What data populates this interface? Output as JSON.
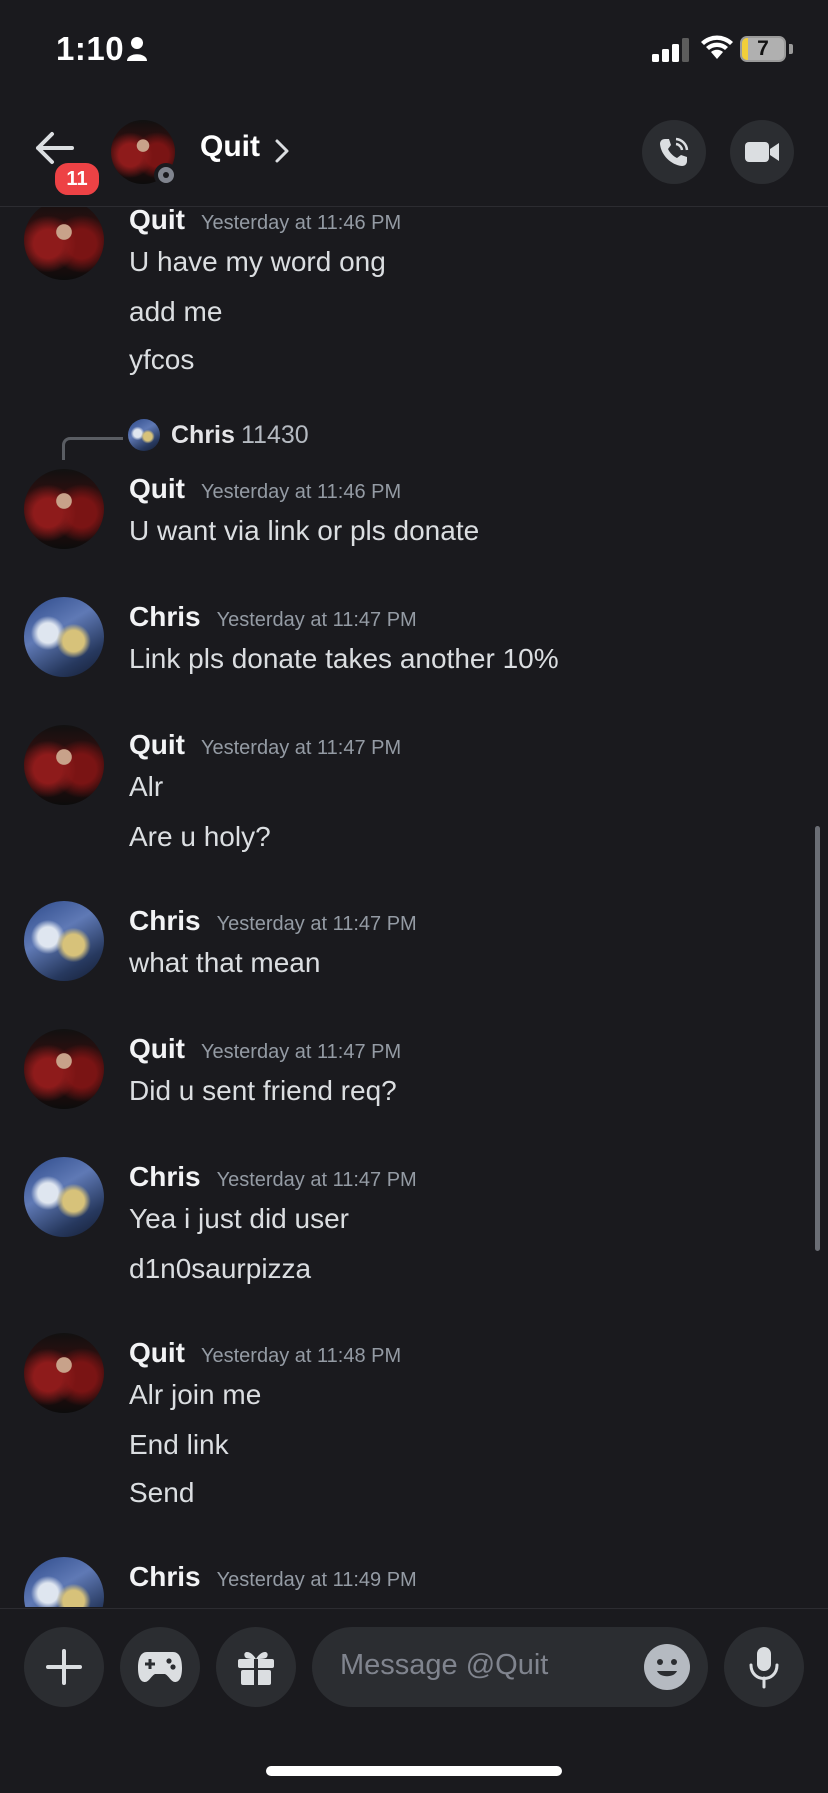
{
  "status_bar": {
    "time": "1:10",
    "battery": "7"
  },
  "header": {
    "back_badge": "11",
    "title": "Quit"
  },
  "reply_preview": {
    "name": "Chris",
    "text": "11430"
  },
  "messages": [
    {
      "author": "Quit",
      "timestamp": "Yesterday at 11:46 PM",
      "lines": [
        "U have my word ong",
        "add me",
        "yfcos"
      ]
    },
    {
      "author": "Quit",
      "timestamp": "Yesterday at 11:46 PM",
      "lines": [
        "U want via link or pls donate"
      ]
    },
    {
      "author": "Chris",
      "timestamp": "Yesterday at 11:47 PM",
      "lines": [
        "Link pls donate takes another 10%"
      ]
    },
    {
      "author": "Quit",
      "timestamp": "Yesterday at 11:47 PM",
      "lines": [
        "Alr",
        "Are u holy?"
      ]
    },
    {
      "author": "Chris",
      "timestamp": "Yesterday at 11:47 PM",
      "lines": [
        "what that mean"
      ]
    },
    {
      "author": "Quit",
      "timestamp": "Yesterday at 11:47 PM",
      "lines": [
        "Did u sent friend req?"
      ]
    },
    {
      "author": "Chris",
      "timestamp": "Yesterday at 11:47 PM",
      "lines": [
        "Yea i just did user",
        "d1n0saurpizza"
      ]
    },
    {
      "author": "Quit",
      "timestamp": "Yesterday at 11:48 PM",
      "lines": [
        "Alr join me",
        "End link",
        "Send"
      ]
    },
    {
      "author": "Chris",
      "timestamp": "Yesterday at 11:49 PM",
      "lines": []
    }
  ],
  "composer": {
    "placeholder": "Message @Quit"
  },
  "icons": [
    "person-icon",
    "signal-icon",
    "wifi-icon",
    "battery-icon",
    "back-arrow-icon",
    "chevron-right-icon",
    "phone-call-icon",
    "video-camera-icon",
    "plus-icon",
    "gamepad-icon",
    "gift-icon",
    "emoji-icon",
    "microphone-icon"
  ],
  "colors": {
    "background": "#1a1a1e",
    "button": "#2b2d31",
    "badge": "#ed4245",
    "text": "#dbdee1",
    "muted": "#949ba4"
  }
}
